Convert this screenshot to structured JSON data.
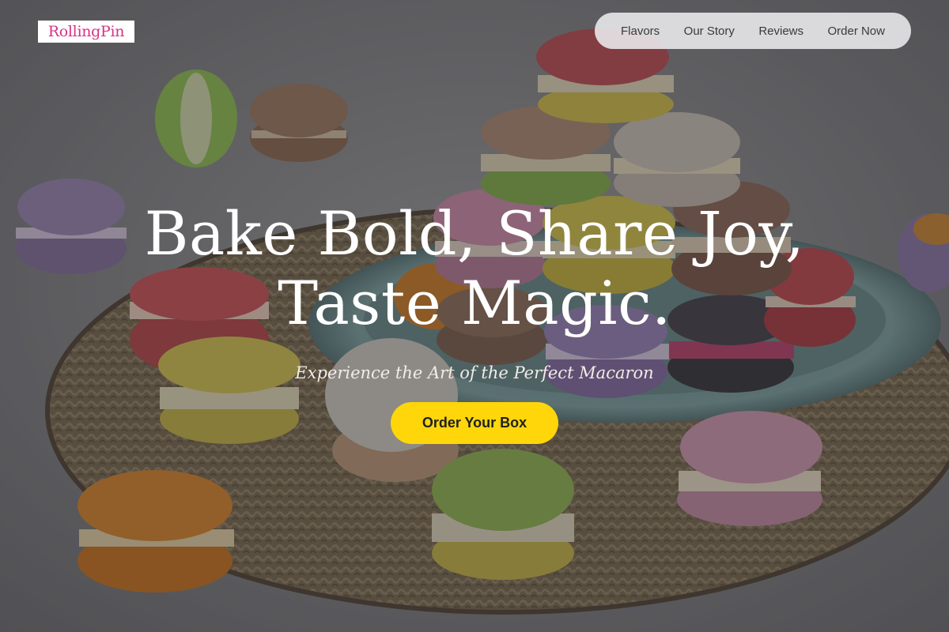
{
  "brand": {
    "logo_text": "RollingPin"
  },
  "nav": {
    "items": [
      {
        "label": "Flavors"
      },
      {
        "label": "Our Story"
      },
      {
        "label": "Reviews"
      },
      {
        "label": "Order Now"
      }
    ]
  },
  "hero": {
    "title_line1": "Bake Bold, Share Joy,",
    "title_line2": "Taste Magic.",
    "subtitle": "Experience the Art of the Perfect Macaron",
    "cta_label": "Order Your Box"
  },
  "colors": {
    "logo_text": "#d63384",
    "cta_background": "#ffd60a",
    "nav_background": "#ececee",
    "hero_text": "#ffffff"
  },
  "icons": [
    "macaron-photo-background"
  ]
}
